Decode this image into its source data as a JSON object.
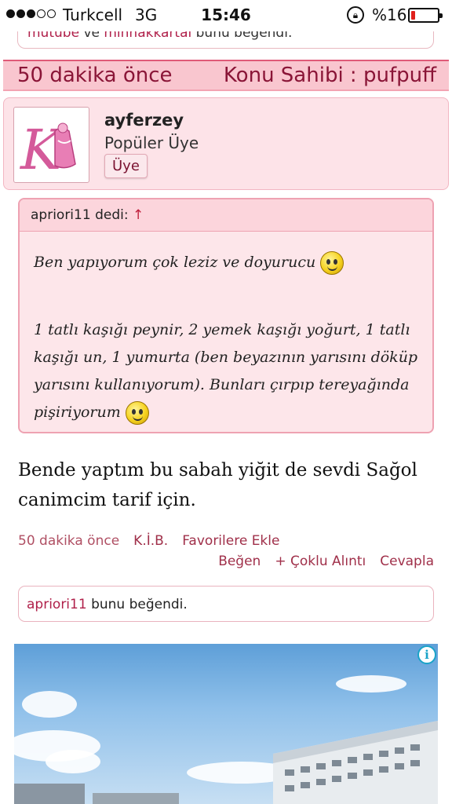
{
  "status_bar": {
    "carrier": "Turkcell",
    "network": "3G",
    "time": "15:46",
    "battery_text": "%16",
    "battery_level": 0.16,
    "battery_color": "#e0201c",
    "signal_strength": 3,
    "lock_icon": "orientation-lock-icon"
  },
  "top_like": {
    "users": [
      "mutube",
      "minnakkartal"
    ],
    "connector": "ve",
    "suffix": "bunu beğendi."
  },
  "post_header": {
    "time": "50 dakika önce",
    "owner": "Konu Sahibi : pufpuff"
  },
  "author": {
    "name": "ayferzey",
    "rank": "Popüler Üye",
    "badge": "Üye",
    "avatar_icon": "letter-k-dress-avatar"
  },
  "quote": {
    "header_user": "apriori11",
    "header_suffix": "dedi:",
    "header_arrow": "↑",
    "line1": "Ben yapıyorum çok leziz ve doyurucu",
    "line2": "1 tatlı kaşığı peynir, 2 yemek kaşığı yoğurt, 1 tatlı kaşığı un, 1 yumurta (ben beyazının yarısını döküp yarısını kullanıyorum). Bunları çırpıp tereyağında pişiriyorum",
    "emoji_icon": "smiley-icon"
  },
  "post": {
    "text": "Bende yaptım bu sabah yiğit de sevdi Sağol canimcim tarif için."
  },
  "meta": {
    "time": "50 dakika önce",
    "kib": "K.İ.B.",
    "favorite": "Favorilere Ekle",
    "like": "Beğen",
    "multi_quote": "+ Çoklu Alıntı",
    "reply": "Cevapla"
  },
  "bottom_like": {
    "user": "apriori11",
    "suffix": "bunu beğendi."
  },
  "ad": {
    "info_icon": "info-icon",
    "info_glyph": "i"
  }
}
